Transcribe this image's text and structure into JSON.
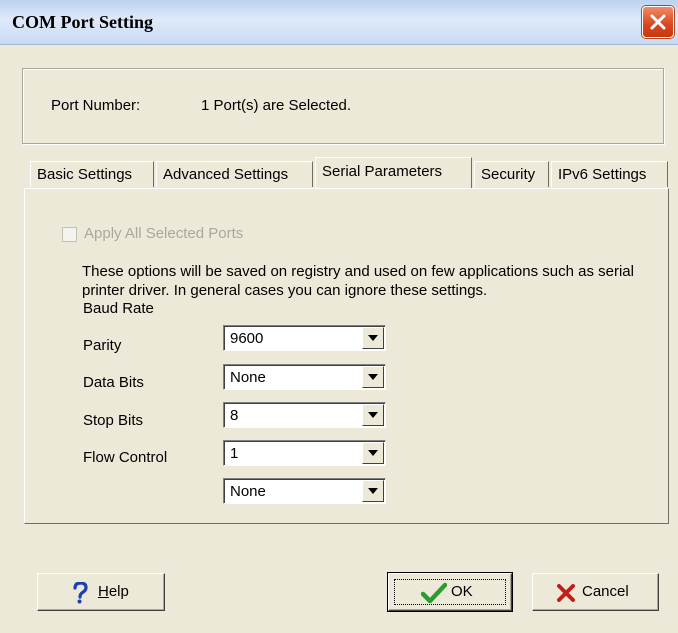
{
  "window": {
    "title": "COM Port Setting",
    "close_icon": "close-icon"
  },
  "port": {
    "label": "Port Number:",
    "value": "1 Port(s) are Selected."
  },
  "tabs": [
    {
      "label": "Basic Settings",
      "active": false
    },
    {
      "label": "Advanced Settings",
      "active": false
    },
    {
      "label": "Serial Parameters",
      "active": true
    },
    {
      "label": "Security",
      "active": false
    },
    {
      "label": "IPv6 Settings",
      "active": false
    }
  ],
  "apply_all": {
    "label": "Apply All Selected Ports",
    "checked": false,
    "enabled": false
  },
  "description": "These options will be saved on registry and used on few applications such as serial printer driver. In general cases you can ignore these settings.",
  "fields": {
    "baud_rate": {
      "label": "Baud Rate",
      "value": "9600"
    },
    "parity": {
      "label": "Parity",
      "value": "None"
    },
    "data_bits": {
      "label": "Data Bits",
      "value": "8"
    },
    "stop_bits": {
      "label": "Stop Bits",
      "value": "1"
    },
    "flow_control": {
      "label": "Flow Control",
      "value": "None"
    }
  },
  "buttons": {
    "help": {
      "label_prefix": "",
      "label_mnemonic": "H",
      "label_rest": "elp",
      "icon": "question-icon"
    },
    "ok": {
      "label": "OK",
      "icon": "checkmark-icon"
    },
    "cancel": {
      "label": "Cancel",
      "icon": "x-icon"
    }
  },
  "colors": {
    "dialog_bg": "#ece9d8",
    "close_red": "#d8461e",
    "ok_green": "#2e9b2e",
    "help_blue": "#1c3fb0",
    "cancel_red": "#c0201a"
  }
}
